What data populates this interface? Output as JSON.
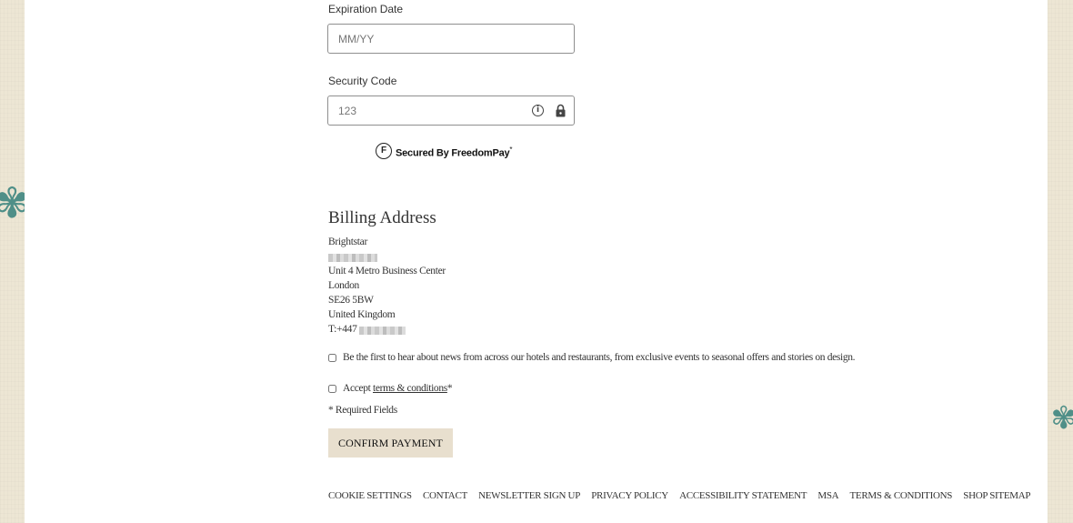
{
  "payment": {
    "expiration_label": "Expiration Date",
    "expiration_placeholder": "MM/YY",
    "security_label": "Security Code",
    "security_placeholder": "123",
    "secured_badge_letter": "F",
    "secured_text": "Secured By FreedomPay",
    "secured_mark": "*"
  },
  "billing": {
    "title": "Billing Address",
    "company": "Brightstar",
    "street": "Unit 4 Metro Business Center",
    "city": "London",
    "postcode": "SE26 5BW",
    "country": "United Kingdom",
    "phone_prefix": "T:+447"
  },
  "consent": {
    "newsletter_text": "Be the first to hear about news from across our hotels and restaurants, from exclusive events to seasonal offers and stories on design.",
    "accept_prefix": "Accept ",
    "terms_link": "terms & conditions",
    "required_mark": "*",
    "required_note": "* Required Fields"
  },
  "actions": {
    "confirm_label": "CONFIRM PAYMENT"
  },
  "footer": {
    "links": [
      "COOKIE SETTINGS",
      "CONTACT",
      "NEWSLETTER SIGN UP",
      "PRIVACY POLICY",
      "ACCESSIBILITY STATEMENT",
      "MSA",
      "TERMS & CONDITIONS",
      "SHOP SITEMAP"
    ]
  },
  "icons": {
    "info": "info-circle-icon",
    "lock": "lock-icon",
    "freedompay": "freedompay-logo-icon"
  },
  "colors": {
    "page_background": "#ede6d4",
    "panel": "#ffffff",
    "button_background": "#e8dfce",
    "decoration": "#4f8f88"
  }
}
